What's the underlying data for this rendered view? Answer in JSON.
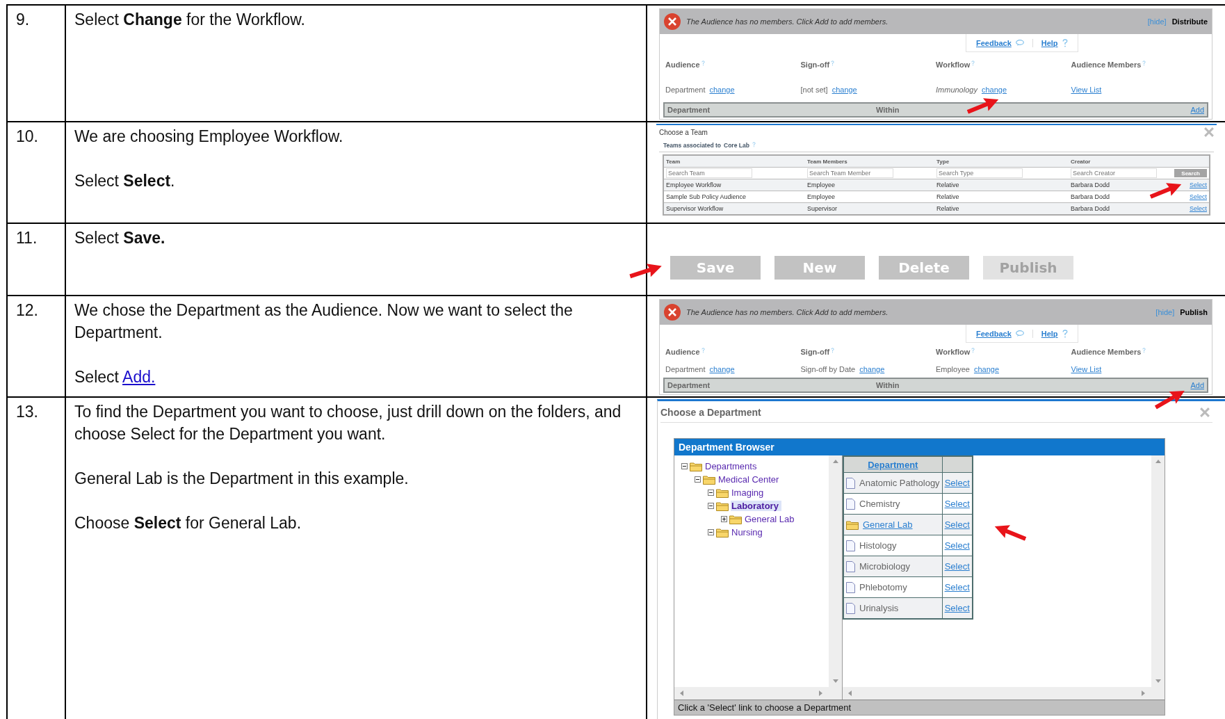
{
  "steps": [
    {
      "number": "9.",
      "paragraphs": [
        {
          "text": "Select **Change** for the Workflow."
        }
      ],
      "screenshot": {
        "kind": "audience_panel",
        "message": "The Audience has no members. Click Add to add members.",
        "hide": "[hide]",
        "action": "Distribute",
        "feedback": "Feedback",
        "help": "Help",
        "fields": [
          {
            "label": "Audience",
            "value": "Department",
            "italic": false,
            "link": "change"
          },
          {
            "label": "Sign-off",
            "value": "[not set]",
            "italic": false,
            "link": "change"
          },
          {
            "label": "Workflow",
            "value": "Immunology",
            "italic": true,
            "link": "change"
          },
          {
            "label": "Audience Members",
            "link": "View List"
          }
        ],
        "columns": [
          "Department",
          "Within"
        ],
        "add": "Add"
      }
    },
    {
      "number": "10.",
      "paragraphs": [
        {
          "text": "We are choosing Employee Workflow."
        },
        {
          "text": "Select **Select**."
        }
      ],
      "screenshot": {
        "kind": "team_picker",
        "title": "Choose a Team",
        "subtitle": "Teams associated to",
        "team": "Core Lab",
        "columns": [
          "Team",
          "Team Members",
          "Type",
          "Creator"
        ],
        "placeholders": [
          "Search Team",
          "Search Team Member",
          "Search Type",
          "Search Creator"
        ],
        "search": "Search",
        "rows": [
          {
            "cells": [
              "Employee Workflow",
              "Employee",
              "Relative",
              "Barbara Dodd"
            ],
            "link": "Select"
          },
          {
            "cells": [
              "Sample Sub Policy Audience",
              "Employee",
              "Relative",
              "Barbara Dodd"
            ],
            "link": "Select"
          },
          {
            "cells": [
              "Supervisor Workflow",
              "Supervisor",
              "Relative",
              "Barbara Dodd"
            ],
            "link": "Select"
          }
        ]
      }
    },
    {
      "number": "11.",
      "paragraphs": [
        {
          "text": "Select **Save.**"
        }
      ],
      "screenshot": {
        "kind": "button_bar",
        "buttons": [
          {
            "label": "Save",
            "disabled": false
          },
          {
            "label": "New",
            "disabled": false
          },
          {
            "label": "Delete",
            "disabled": false
          },
          {
            "label": "Publish",
            "disabled": true
          }
        ]
      }
    },
    {
      "number": "12.",
      "paragraphs": [
        {
          "text": "We chose the Department as the Audience.  Now we want to select the Department."
        },
        {
          "text": "Select ",
          "link": "Add."
        }
      ],
      "screenshot": {
        "kind": "audience_panel",
        "message": "The Audience has no members. Click Add to add members.",
        "hide": "[hide]",
        "action": "Publish",
        "feedback": "Feedback",
        "help": "Help",
        "fields": [
          {
            "label": "Audience",
            "value": "Department",
            "italic": false,
            "link": "change"
          },
          {
            "label": "Sign-off",
            "value": "Sign-off by Date",
            "italic": false,
            "link": "change"
          },
          {
            "label": "Workflow",
            "value": "Employee",
            "italic": false,
            "link": "change"
          },
          {
            "label": "Audience Members",
            "link": "View List"
          }
        ],
        "columns": [
          "Department",
          "Within"
        ],
        "add": "Add"
      }
    },
    {
      "number": "13.",
      "paragraphs": [
        {
          "text": "To find the Department you want to choose, just drill down on the folders, and choose Select for the Department you want."
        },
        {
          "text": "General Lab is the Department in this example."
        },
        {
          "text": "Choose **Select** for General Lab."
        }
      ],
      "screenshot": {
        "kind": "department_browser",
        "title": "Choose a Department",
        "browser_title": "Department Browser",
        "tree": [
          {
            "label": "Departments",
            "expanded": true,
            "selected": false,
            "children": [
              {
                "label": "Medical Center",
                "expanded": true,
                "selected": false,
                "children": [
                  {
                    "label": "Imaging",
                    "expanded": true,
                    "selected": false
                  },
                  {
                    "label": "Laboratory",
                    "expanded": true,
                    "selected": true,
                    "children": [
                      {
                        "label": "General Lab",
                        "expanded": false,
                        "selected": false
                      }
                    ]
                  },
                  {
                    "label": "Nursing",
                    "expanded": true,
                    "selected": false
                  }
                ]
              }
            ]
          }
        ],
        "column": "Department",
        "rows": [
          {
            "name": "Anatomic Pathology",
            "kind": "file",
            "link": "Select"
          },
          {
            "name": "Chemistry",
            "kind": "file",
            "link": "Select"
          },
          {
            "name": "General Lab",
            "kind": "folder",
            "link": "Select"
          },
          {
            "name": "Histology",
            "kind": "file",
            "link": "Select"
          },
          {
            "name": "Microbiology",
            "kind": "file",
            "link": "Select"
          },
          {
            "name": "Phlebotomy",
            "kind": "file",
            "link": "Select"
          },
          {
            "name": "Urinalysis",
            "kind": "file",
            "link": "Select"
          }
        ],
        "status": "Click a 'Select' link to choose a Department"
      }
    }
  ]
}
